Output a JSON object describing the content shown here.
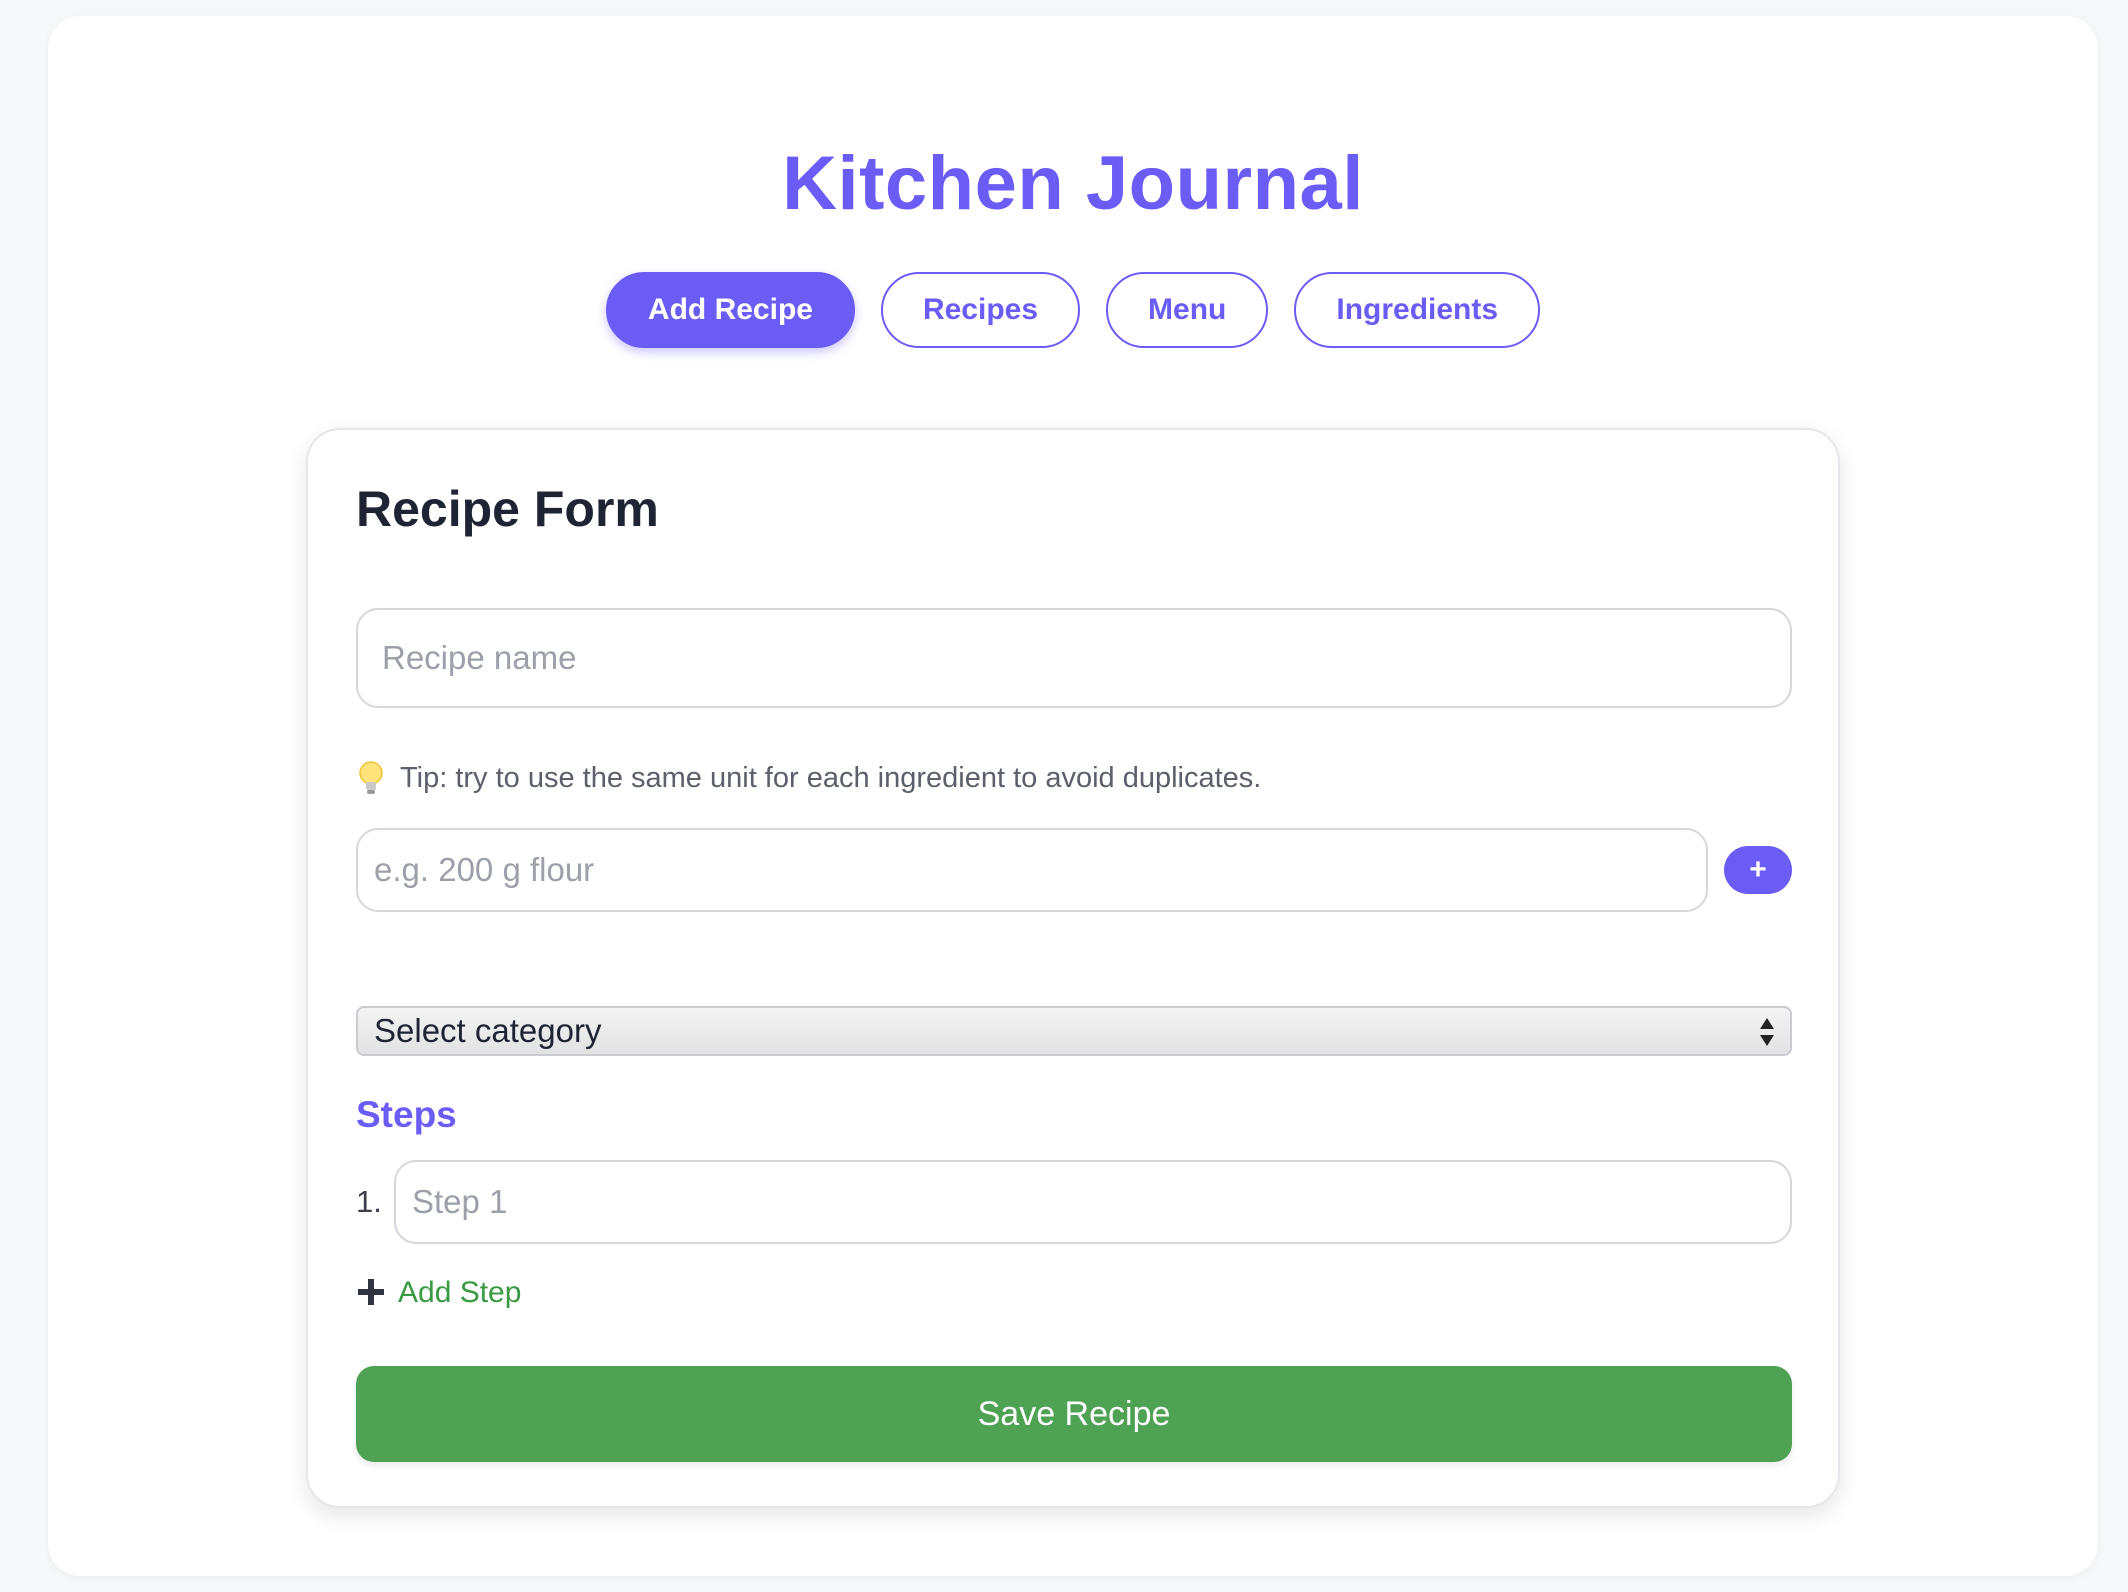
{
  "app": {
    "title": "Kitchen Journal"
  },
  "nav": {
    "tabs": [
      {
        "label": "Add Recipe",
        "active": true
      },
      {
        "label": "Recipes",
        "active": false
      },
      {
        "label": "Menu",
        "active": false
      },
      {
        "label": "Ingredients",
        "active": false
      }
    ]
  },
  "form": {
    "title": "Recipe Form",
    "name_placeholder": "Recipe name",
    "tip_text": "Tip: try to use the same unit for each ingredient to avoid duplicates.",
    "tip_icon": "lightbulb-icon",
    "ingredient_placeholder": "e.g. 200 g flour",
    "add_ingredient_label": "+",
    "category_selected": "Select category",
    "steps_heading": "Steps",
    "steps": [
      {
        "number": "1.",
        "placeholder": "Step 1"
      }
    ],
    "add_step_label": "Add Step",
    "save_label": "Save Recipe"
  },
  "colors": {
    "accent": "#6a5cf5",
    "save": "#4fa154",
    "add_step": "#3a9a43"
  }
}
